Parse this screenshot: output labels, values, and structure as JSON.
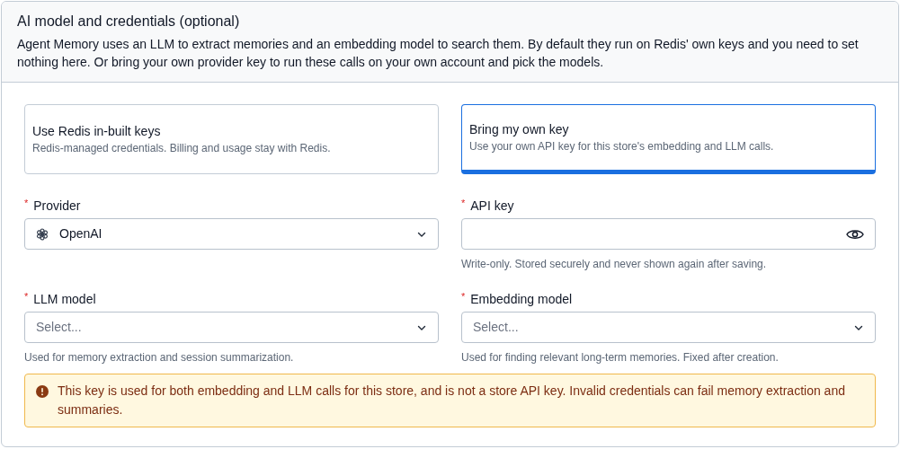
{
  "section": {
    "title": "AI model and credentials (optional)",
    "description": "Agent Memory uses an LLM to extract memories and an embedding model to search them. By default they run on Redis' own keys and you need to set nothing here. Or bring your own provider key to run these calls on your own account and pick the models."
  },
  "options": [
    {
      "title": "Use Redis in-built keys",
      "description": "Redis-managed credentials. Billing and usage stay with Redis.",
      "selected": false
    },
    {
      "title": "Bring my own key",
      "description": "Use your own API key for this store's embedding and LLM calls.",
      "selected": true
    }
  ],
  "fields": [
    {
      "kind": "select",
      "label": "Provider",
      "required_mark": "*",
      "value": "OpenAI"
    },
    {
      "kind": "password",
      "label": "API key",
      "required_mark": "*",
      "helper": "Write-only. Stored securely and never shown again after saving."
    },
    {
      "kind": "select",
      "label": "LLM model",
      "required_mark": "*",
      "placeholder": "Select...",
      "helper": "Used for memory extraction and session summarization."
    },
    {
      "kind": "select",
      "label": "Embedding model",
      "required_mark": "*",
      "placeholder": "Select...",
      "helper": "Used for finding relevant long-term memories. Fixed after creation."
    }
  ],
  "alert": {
    "kind": "warning",
    "text": "This key is used for both embedding and LLM calls for this store, and is not a store API key. Invalid credentials can fail memory extraction and summaries."
  }
}
